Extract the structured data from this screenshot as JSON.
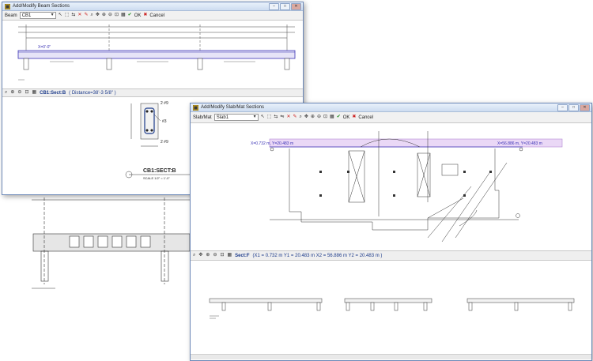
{
  "beam_window": {
    "title": "Add/Modify Beam Sections",
    "toolbar": {
      "field_label": "Beam",
      "field_value": "CB1",
      "ok_label": "OK",
      "cancel_label": "Cancel"
    },
    "status": {
      "section_name": "CB1:Sect:B",
      "section_info": "( Distance=38'-3 5/8\" )"
    },
    "drawing_labels": {
      "x_label": "X=0'-0\"",
      "section_title": "CB1:SECT:B",
      "section_scale": "SCALE 1/2\" = 1'-0\"",
      "rebar_top": "2 #9",
      "rebar_mid": "#3",
      "rebar_bot": "2 #9"
    }
  },
  "slab_window": {
    "title": "Add/Modify Slab/Mat Sections",
    "toolbar": {
      "field_label": "Slab/Mat",
      "field_value": "Slab1",
      "ok_label": "OK",
      "cancel_label": "Cancel"
    },
    "status": {
      "section_name": "Sect:F",
      "section_info": "(X1 = 0.732 m  Y1 = 20.483 m   X2 = 56.886 m  Y2 = 20.483 m )"
    },
    "drawing_labels": {
      "left_point": "X=0.732 m, Y=20.483 m",
      "right_point": "X=56.886 m, Y=20.483 m"
    }
  },
  "icons": [
    "window-app-icon",
    "minimize-icon",
    "maximize-icon",
    "close-icon",
    "pointer-icon",
    "select-box-icon",
    "add-section-icon",
    "pencil-icon",
    "delete-icon",
    "zoom-icon",
    "pan-icon",
    "zoom-in-icon",
    "zoom-out-icon",
    "zoom-fit-icon",
    "properties-icon",
    "check-icon",
    "cancel-icon"
  ]
}
